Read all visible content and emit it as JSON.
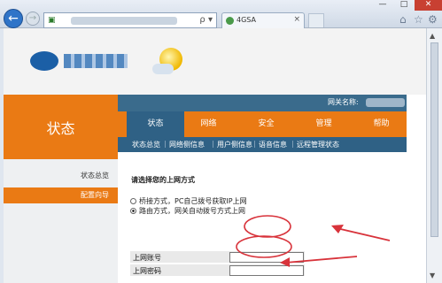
{
  "browser": {
    "back_icon": "back-arrow-icon",
    "forward_icon": "forward-arrow-icon",
    "address_search_glyph": "ρ",
    "address_dropdown_glyph": "▾",
    "tab_title": "4GSA",
    "tab_close": "×",
    "window_min": "—",
    "window_max": "□",
    "window_close": "✕",
    "toolbar_icons": [
      "home-icon",
      "star-icon",
      "gear-icon"
    ]
  },
  "router": {
    "gateway_name_label": "网关名称:",
    "status_heading": "状态",
    "nav": [
      "状态",
      "网络",
      "安全",
      "管理",
      "帮助"
    ],
    "subnav": [
      "状态总览",
      "网络侧信息",
      "用户侧信息",
      "语音信息",
      "远程管理状态"
    ],
    "sidebar": [
      "状态总览",
      "配置向导"
    ],
    "section_title": "请选择您的上网方式",
    "options": [
      {
        "label": "桥接方式，PC自己拨号获取IP上网",
        "selected": false
      },
      {
        "label": "路由方式，网关自动拨号方式上网",
        "selected": true
      }
    ],
    "fields": [
      {
        "label": "上网账号",
        "value": ""
      },
      {
        "label": "上网密码",
        "value": ""
      }
    ]
  },
  "colors": {
    "orange": "#ea7a14",
    "blue": "#2f6185",
    "annotation_red": "#d8333b"
  }
}
